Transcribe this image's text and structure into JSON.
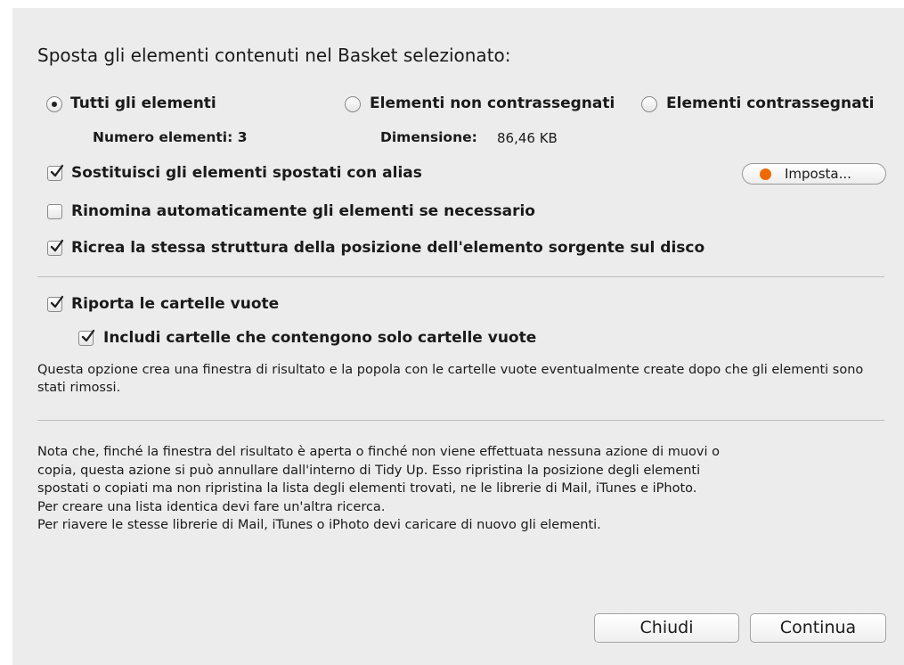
{
  "dialog": {
    "heading": "Sposta gli elementi contenuti nel Basket selezionato:",
    "radios": [
      {
        "label": "Tutti gli elementi",
        "selected": true
      },
      {
        "label": "Elementi non contrassegnati",
        "selected": false
      },
      {
        "label": "Elementi contrassegnati",
        "selected": false
      }
    ],
    "count_label": "Numero elementi: 3",
    "size_label": "Dimensione:",
    "size_value": "86,46 KB",
    "options": {
      "replace_alias": {
        "label": "Sostituisci gli elementi spostati con alias",
        "checked": true
      },
      "rename_auto": {
        "label": "Rinomina automaticamente gli elementi se necessario",
        "checked": false
      },
      "recreate_structure": {
        "label": "Ricrea la stessa struttura della posizione dell'elemento sorgente sul disco",
        "checked": true
      },
      "report_empty": {
        "label": "Riporta le cartelle vuote",
        "checked": true
      },
      "include_nested": {
        "label": "Includi cartelle che contengono solo cartelle vuote",
        "checked": true
      }
    },
    "set_button_label": "Imposta...",
    "set_button_color": "#ee6a00",
    "empty_folders_desc": "Questa opzione crea una finestra di risultato e la popola con le cartelle vuote eventualmente create dopo che gli elementi sono stati rimossi.",
    "note_lines": [
      "Nota che, finché la finestra del risultato è aperta o finché non viene effettuata nessuna azione di muovi o",
      "copia, questa azione si può annullare dall'interno di Tidy Up. Esso ripristina la posizione degli elementi",
      "spostati o copiati ma non ripristina la lista degli elementi trovati, ne le librerie di Mail, iTunes e iPhoto.",
      "Per creare una lista identica devi fare un'altra ricerca.",
      "Per riavere le stesse librerie di Mail, iTunes o iPhoto devi caricare di nuovo gli elementi."
    ],
    "buttons": {
      "close": "Chiudi",
      "continue": "Continua"
    }
  }
}
